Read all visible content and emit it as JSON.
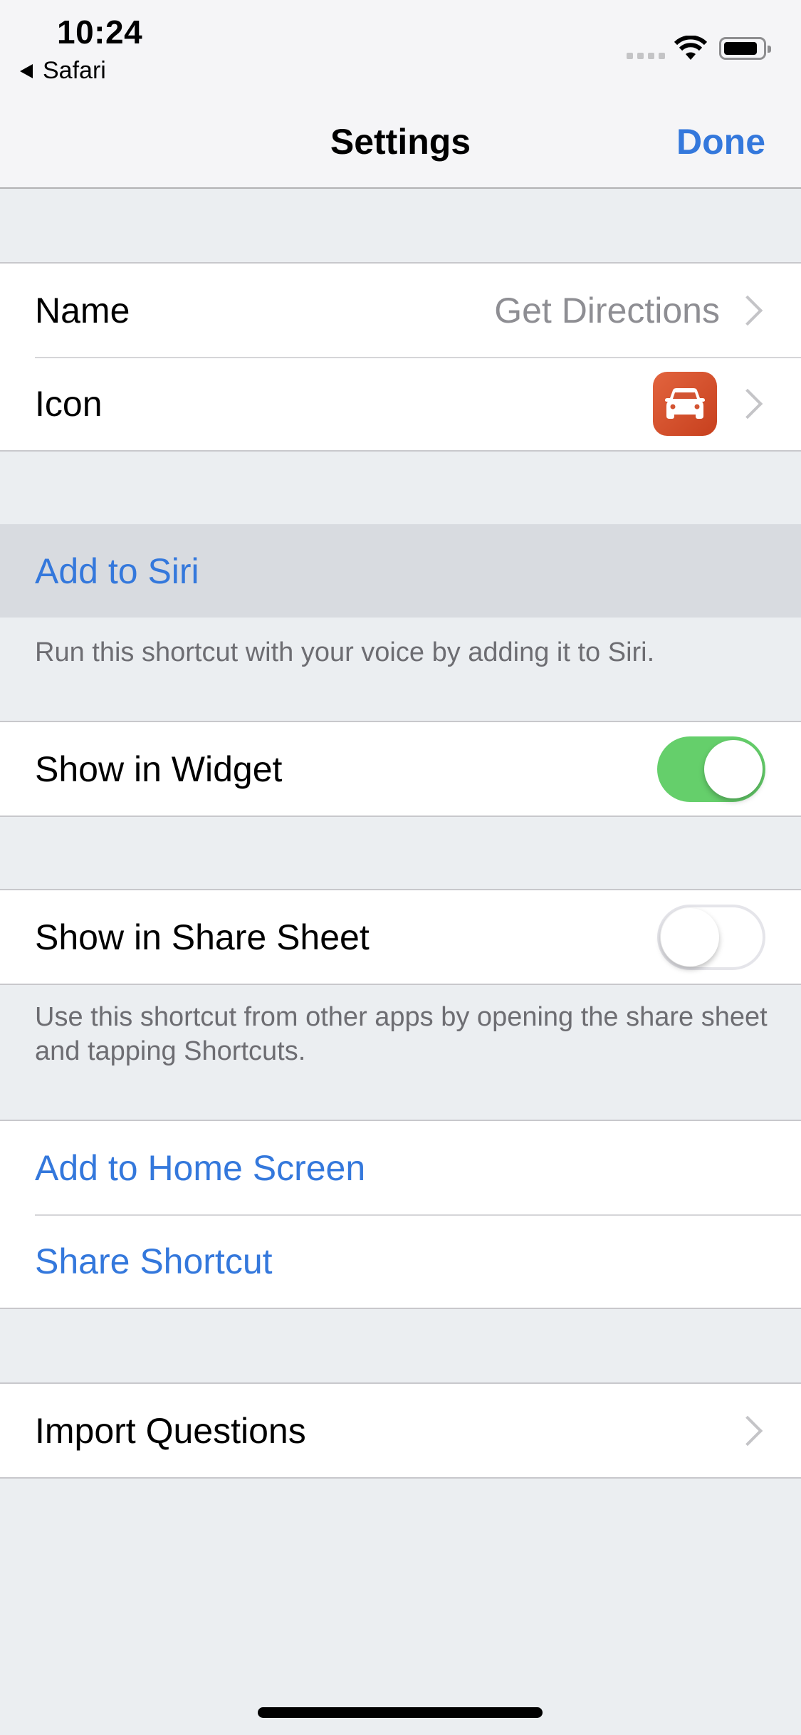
{
  "status_bar": {
    "time": "10:24",
    "back_app": "Safari",
    "icons": [
      "signal-dots-icon",
      "wifi-icon",
      "battery-icon"
    ]
  },
  "nav": {
    "title": "Settings",
    "done_label": "Done"
  },
  "colors": {
    "accent": "#3478dc",
    "toggle_on": "#65cf6b",
    "icon_bg": "#d9512d"
  },
  "general": {
    "name_label": "Name",
    "name_value": "Get Directions",
    "icon_label": "Icon",
    "icon_glyph": "car-icon"
  },
  "siri": {
    "label": "Add to Siri",
    "footer": "Run this shortcut with your voice by adding it to Siri."
  },
  "widget": {
    "label": "Show in Widget",
    "enabled": true
  },
  "share_sheet": {
    "label": "Show in Share Sheet",
    "enabled": false,
    "footer": "Use this shortcut from other apps by opening the share sheet and tapping Shortcuts."
  },
  "actions": {
    "home_screen_label": "Add to Home Screen",
    "share_label": "Share Shortcut"
  },
  "import": {
    "label": "Import Questions"
  }
}
